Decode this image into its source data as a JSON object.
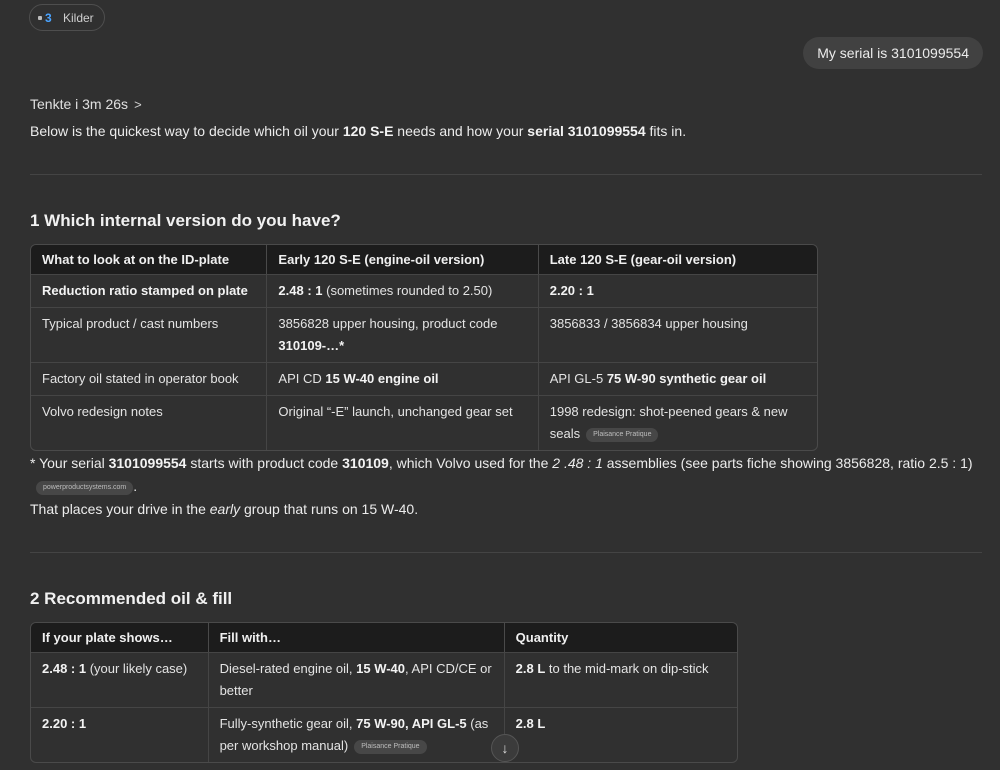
{
  "sources": {
    "label": "Kilder",
    "favicon_icon": "source-favicon-icon"
  },
  "user_message": "My serial is 3101099554",
  "thinking": {
    "label": "Tenkte i 3m 26s",
    "chevron": ">"
  },
  "intro": {
    "t1": "Below is the quickest way to decide which oil your ",
    "b1": "120 S-E",
    "t2": " needs and how your ",
    "b2": "serial 3101099554",
    "t3": " fits in."
  },
  "section1": {
    "title": "1 Which internal version do you have?",
    "headers": [
      "What to look at on the ID-plate",
      "Early 120 S-E (engine-oil version)",
      "Late 120 S-E (gear-oil version)"
    ],
    "r1": {
      "c1": "Reduction ratio stamped on plate",
      "c2b": "2.48 : 1",
      "c2t": " (sometimes rounded to 2.50)",
      "c3b": "2.20 : 1"
    },
    "r2": {
      "c1": "Typical product / cast numbers",
      "c2t": "3856828 upper housing, product code ",
      "c2b": "310109-…*",
      "c3t": "3856833 / 3856834 upper housing"
    },
    "r3": {
      "c1": "Factory oil stated in operator book",
      "c2t": "API CD ",
      "c2b": "15 W-40 engine oil",
      "c3t": "API GL-5 ",
      "c3b": "75 W-90 synthetic gear oil"
    },
    "r4": {
      "c1": "Volvo redesign notes",
      "c2t": "Original “-E” launch, unchanged gear set",
      "c3t": "1998 redesign: shot-peened gears & new seals",
      "c3cite": "Plaisance Pratique"
    }
  },
  "note": {
    "t1": "* Your serial ",
    "b1": "3101099554",
    "t2": " starts with product code ",
    "b2": "310109",
    "t3": ", which Volvo used for the ",
    "i1": "2 .48 : 1",
    "t4": " assemblies (see parts fiche showing 3856828, ratio 2.5 : 1)",
    "cite": "powerproductsystems.com",
    "t5": ".",
    "line2a": "That places your drive in the ",
    "line2i": "early",
    "line2b": " group that runs on 15 W-40."
  },
  "section2": {
    "title": "2 Recommended oil & fill",
    "headers": [
      "If your plate shows…",
      "Fill with…",
      "Quantity"
    ],
    "r1": {
      "c1b": "2.48 : 1",
      "c1t": " (your likely case)",
      "c2t": "Diesel-rated engine oil, ",
      "c2b": "15 W-40",
      "c2t2": ", API CD/CE or better",
      "c3b": "2.8 L",
      "c3t": " to the mid-mark on dip-stick"
    },
    "r2": {
      "c1b": "2.20 : 1",
      "c2t": "Fully-synthetic gear oil, ",
      "c2b": "75 W-90, API GL-5",
      "c2t2": " (as per workshop manual)",
      "c2cite": "Plaisance Pratique",
      "c3b": "2.8 L"
    }
  },
  "scroll_button": {
    "glyph": "↓"
  }
}
